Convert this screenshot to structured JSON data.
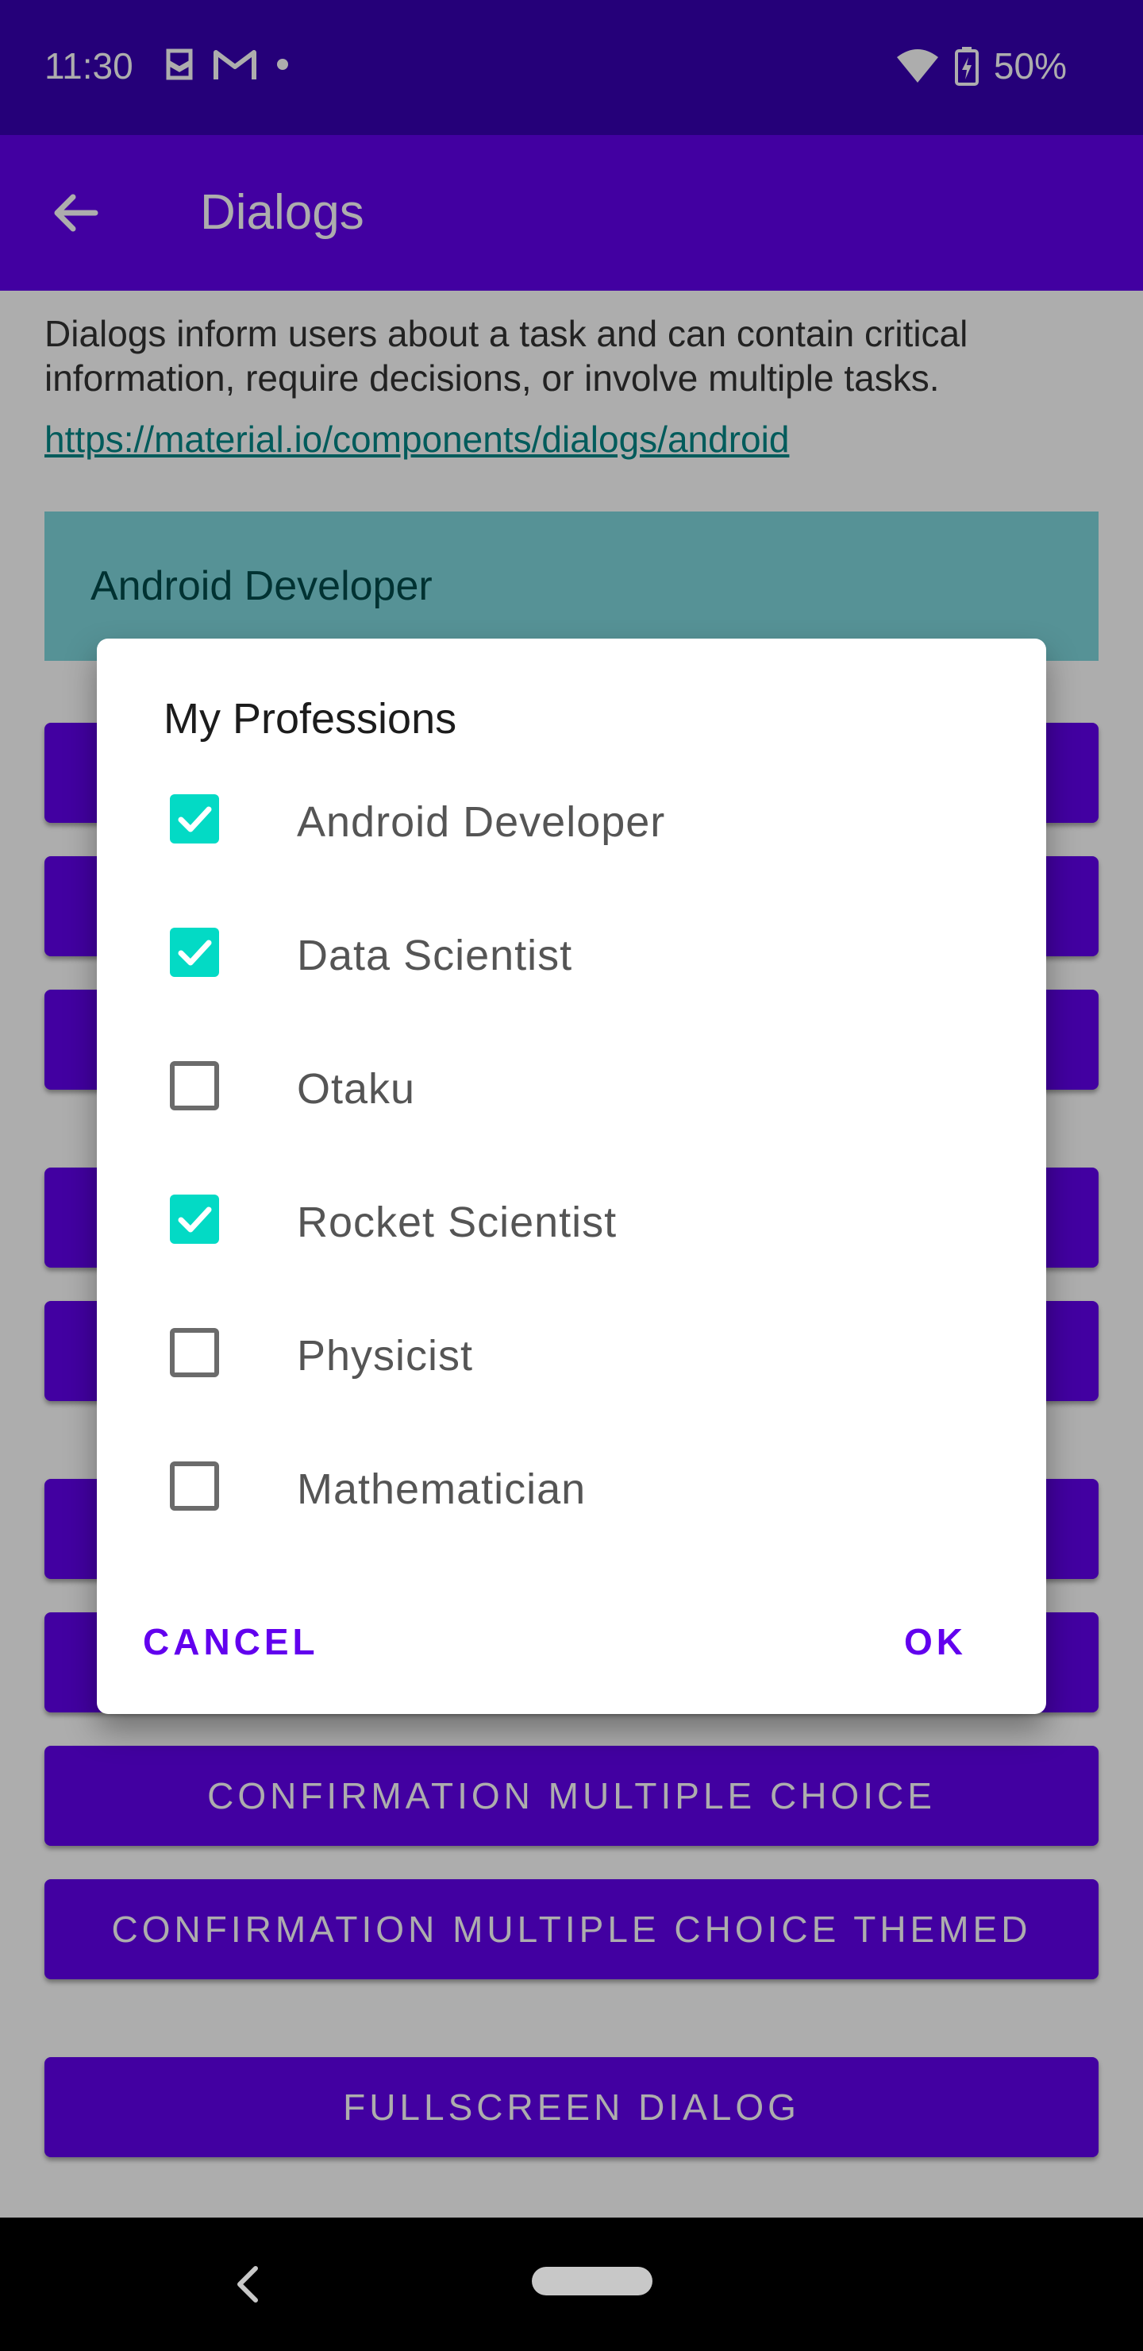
{
  "status": {
    "time": "11:30",
    "battery": "50%"
  },
  "appbar": {
    "title": "Dialogs"
  },
  "content": {
    "description": "Dialogs inform users about a task and can contain critical information, require decisions, or involve multiple tasks.",
    "link": "https://material.io/components/dialogs/android",
    "selected_text": "Android Developer",
    "buttons": [
      "",
      "",
      "",
      "",
      "",
      "",
      "",
      "CONFIRMATION MULTIPLE CHOICE",
      "CONFIRMATION MULTIPLE CHOICE THEMED",
      "FULLSCREEN DIALOG"
    ]
  },
  "dialog": {
    "title": "My Professions",
    "options": [
      {
        "label": "Android Developer",
        "checked": true
      },
      {
        "label": "Data Scientist",
        "checked": true
      },
      {
        "label": "Otaku",
        "checked": false
      },
      {
        "label": "Rocket Scientist",
        "checked": true
      },
      {
        "label": "Physicist",
        "checked": false
      },
      {
        "label": "Mathematician",
        "checked": false
      }
    ],
    "cancel_label": "CANCEL",
    "ok_label": "OK"
  },
  "colors": {
    "primary": "#6200ee",
    "primary_dark": "#3700b3",
    "accent": "#03dac5"
  }
}
